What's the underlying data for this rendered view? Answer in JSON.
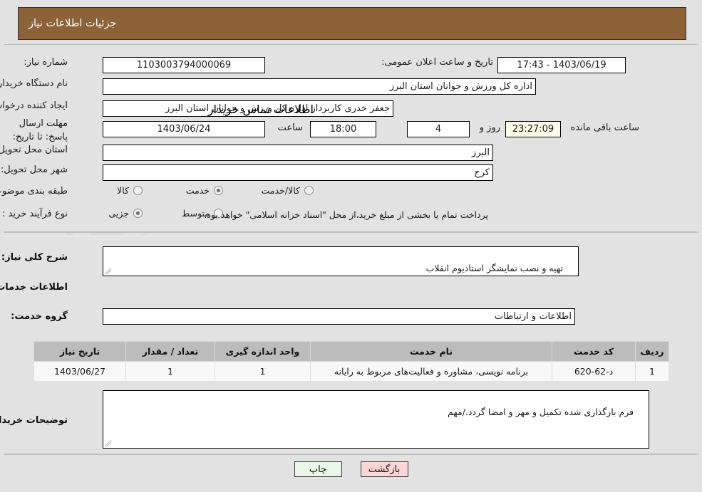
{
  "header": {
    "title": "جزئیات اطلاعات نیاز"
  },
  "form": {
    "need_number": {
      "label": "شماره نیاز:",
      "value": "1103003794000069"
    },
    "announce_datetime": {
      "label": "تاریخ و ساعت اعلان عمومی:",
      "value": "1403/06/19 - 17:43"
    },
    "buyer_org": {
      "label": "نام دستگاه خریدار:",
      "value": "اداره کل ورزش و جوانان استان البرز"
    },
    "requester": {
      "label": "ایجاد کننده درخواست:",
      "value": "جعفر خدری کاربرداز اداره کل ورزش و جوانان استان البرز"
    },
    "contact_link": "اطلاعات تماس خریدار",
    "deadline": {
      "label": "مهلت ارسال پاسخ: تا تاریخ:",
      "date": "1403/06/24",
      "time_label": "ساعت",
      "time": "18:00",
      "days": "4",
      "days_label": "روز و",
      "countdown": "23:27:09",
      "remaining_label": "ساعت باقی مانده"
    },
    "province": {
      "label": "استان محل تحویل:",
      "value": "البرز"
    },
    "city": {
      "label": "شهر محل تحویل:",
      "value": "کرج"
    },
    "category": {
      "label": "طبقه بندی موضوعی:",
      "options": [
        "کالا",
        "خدمت",
        "کالا/خدمت"
      ],
      "selected": "خدمت"
    },
    "purchase_type": {
      "label": "نوع فرآیند خرید :",
      "options": [
        "جزیی",
        "متوسط"
      ],
      "selected": "جزیی",
      "note": "پرداخت تمام یا بخشی از مبلغ خرید،از محل \"اسناد خزانه اسلامی\" خواهد بود."
    },
    "general_desc": {
      "label": "شرح کلی نیاز:",
      "value": "تهیه و نصب نمایشگر استادیوم انقلاب"
    },
    "services_section_title": "اطلاعات خدمات مورد نیاز",
    "service_group": {
      "label": "گروه خدمت:",
      "value": "اطلاعات و ارتباطات"
    },
    "buyer_notes": {
      "label": "توضیحات خریدار:",
      "value": "فرم بارگذاری شده تکمیل و مهر و امضا گردد./مهم"
    }
  },
  "table": {
    "columns": [
      "ردیف",
      "کد خدمت",
      "نام خدمت",
      "واحد اندازه گیری",
      "تعداد / مقدار",
      "تاریخ نیاز"
    ],
    "rows": [
      {
        "row": "1",
        "code": "د-62-620",
        "name": "برنامه نویسی، مشاوره و فعالیت‌های مربوط به رایانه",
        "unit": "1",
        "qty": "1",
        "need_date": "1403/06/27"
      }
    ]
  },
  "buttons": {
    "print": "چاپ",
    "back": "بازگشت"
  },
  "colors": {
    "header_bg": "#8c6239",
    "link": "#1745c6",
    "countdown_bg": "#fbfbe8",
    "print_bg": "#e9f7e9",
    "back_bg": "#fbd6d6",
    "table_header_bg": "#bcbcbc"
  }
}
